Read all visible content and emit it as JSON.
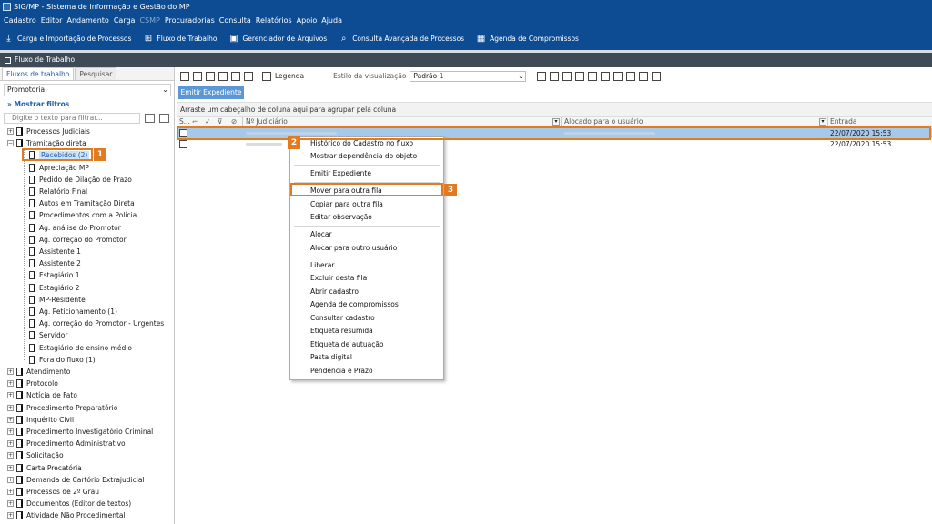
{
  "window": {
    "title": "SIG/MP - Sistema de Informação e Gestão do MP"
  },
  "menu": [
    "Cadastro",
    "Editor",
    "Andamento",
    "Carga",
    "CSMP",
    "Procuradorias",
    "Consulta",
    "Relatórios",
    "Apoio",
    "Ajuda"
  ],
  "menu_disabled": "CSMP",
  "toolbar": [
    {
      "label": "Carga e Importação de Processos",
      "icon": "download-arrow-icon"
    },
    {
      "label": "Fluxo de Trabalho",
      "icon": "workflow-tree-icon"
    },
    {
      "label": "Gerenciador de Arquivos",
      "icon": "file-manager-icon"
    },
    {
      "label": "Consulta Avançada de Processos",
      "icon": "search-icon"
    },
    {
      "label": "Agenda de Compromissos",
      "icon": "calendar-icon"
    }
  ],
  "panel": {
    "title": "Fluxo de Trabalho"
  },
  "left": {
    "tabs": [
      "Fluxos de trabalho",
      "Pesquisar"
    ],
    "queue": "Promotoria",
    "show_filters": "Mostrar filtros",
    "filter_placeholder": "Digite o texto para filtrar...",
    "tree_roots_top": [
      "Processos Judiciais",
      "Tramitação direta"
    ],
    "tree_children": [
      "Recebidos (2)",
      "Apreciação MP",
      "Pedido de Dilação de Prazo",
      "Relatório Final",
      "Autos em Tramitação Direta",
      "Procedimentos com a Polícia",
      "Ag. análise do Promotor",
      "Ag. correção do Promotor",
      "Assistente 1",
      "Assistente 2",
      "Estagiário 1",
      "Estagiário 2",
      "MP-Residente",
      "Ag. Peticionamento (1)",
      "Ag. correção do Promotor - Urgentes",
      "Servidor",
      "Estagiário de ensino médio",
      "Fora do fluxo (1)"
    ],
    "tree_roots_bottom": [
      "Atendimento",
      "Protocolo",
      "Notícia de Fato",
      "Procedimento Preparatório",
      "Inquérito Civil",
      "Procedimento Investigatório Criminal",
      "Procedimento Administrativo",
      "Solicitação",
      "Carta Precatória",
      "Demanda de Cartório Extrajudicial",
      "Processos de 2º Grau",
      "Documentos (Editor de textos)",
      "Atividade Não Procedimental"
    ]
  },
  "grid": {
    "legend": "Legenda",
    "view_label": "Estilo da visualização",
    "view_value": "Padrão 1",
    "emit_button": "Emitir Expediente",
    "group_hint": "Arraste um cabeçalho de coluna aqui para agrupar pela coluna",
    "col_sel": "S...",
    "col_judicial": "Nº Judiciário",
    "col_alocado": "Alocado para o usuário",
    "col_entrada": "Entrada",
    "rows": [
      {
        "entrada": "22/07/2020 15:53"
      },
      {
        "entrada": "22/07/2020 15:53"
      }
    ]
  },
  "context_menu": [
    "Histórico do Cadastro no fluxo",
    "Mostrar dependência do objeto",
    "Emitir Expediente",
    "Mover para outra fila",
    "Copiar para outra fila",
    "Editar observação",
    "Alocar",
    "Alocar para outro usuário",
    "Liberar",
    "Excluir desta fila",
    "Abrir cadastro",
    "Agenda de compromissos",
    "Consultar cadastro",
    "Etiqueta resumida",
    "Etiqueta de autuação",
    "Pasta digital",
    "Pendência e Prazo"
  ],
  "callouts": [
    "1",
    "2",
    "3"
  ],
  "colors": {
    "brand": "#0d4b93",
    "highlight": "#e07b22",
    "selection": "#a6c9ea"
  }
}
